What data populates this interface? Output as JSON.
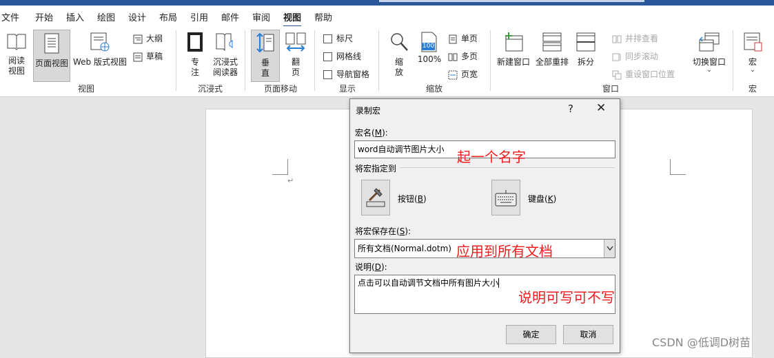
{
  "menu": {
    "tabs": [
      "文件",
      "开始",
      "插入",
      "绘图",
      "设计",
      "布局",
      "引用",
      "邮件",
      "审阅",
      "视图",
      "帮助"
    ],
    "active": "视图"
  },
  "ribbon": {
    "view_group": {
      "label": "视图",
      "read_view": [
        "阅读",
        "视图"
      ],
      "print_layout": "页面视图",
      "web_layout": "Web 版式视图",
      "outline": "大纲",
      "draft": "草稿"
    },
    "immersive_group": {
      "label": "沉浸式",
      "focus": [
        "专",
        "注"
      ],
      "immersive_reader": [
        "沉浸式",
        "阅读器"
      ]
    },
    "page_move_group": {
      "label": "页面移动",
      "vertical": [
        "垂",
        "直"
      ],
      "side_to_side": [
        "翻",
        "页"
      ]
    },
    "show_group": {
      "label": "显示",
      "ruler": "标尺",
      "gridlines": "网格线",
      "nav_pane": "导航窗格"
    },
    "zoom_group": {
      "label": "缩放",
      "zoom": [
        "缩",
        "放"
      ],
      "hundred_badge": "100",
      "hundred": "100%",
      "one_page": "单页",
      "multiple_pages": "多页",
      "page_width": "页宽"
    },
    "window_group": {
      "label": "窗口",
      "new_window": "新建窗口",
      "arrange_all": "全部重排",
      "split": "拆分",
      "side_by_side": "并排查看",
      "sync_scroll": "同步滚动",
      "reset_position": "重设窗口位置",
      "switch_windows": "切换窗口"
    },
    "macro_group": {
      "label": "宏",
      "macros": "宏"
    }
  },
  "document": {
    "pilcrow": "↵"
  },
  "dialog": {
    "title": "录制宏",
    "help": "?",
    "close": "✕",
    "macro_name_label": "宏名",
    "macro_name_key": "M",
    "macro_name_value": "word自动调节图片大小",
    "assign_label": "将宏指定到",
    "button_label": "按钮",
    "button_key": "B",
    "keyboard_label": "键盘",
    "keyboard_key": "K",
    "store_label": "将宏保存在",
    "store_key": "S",
    "store_value": "所有文档(Normal.dotm)",
    "desc_label": "说明",
    "desc_key": "D",
    "desc_value": "点击可以自动调节文档中所有图片大小",
    "ok": "确定",
    "cancel": "取消"
  },
  "annotations": {
    "name_note": "起一个名字",
    "store_note": "应用到所有文档",
    "desc_note": "说明可写可不写",
    "color": "#ee1c1c"
  },
  "watermark": "CSDN @低调D树苗"
}
